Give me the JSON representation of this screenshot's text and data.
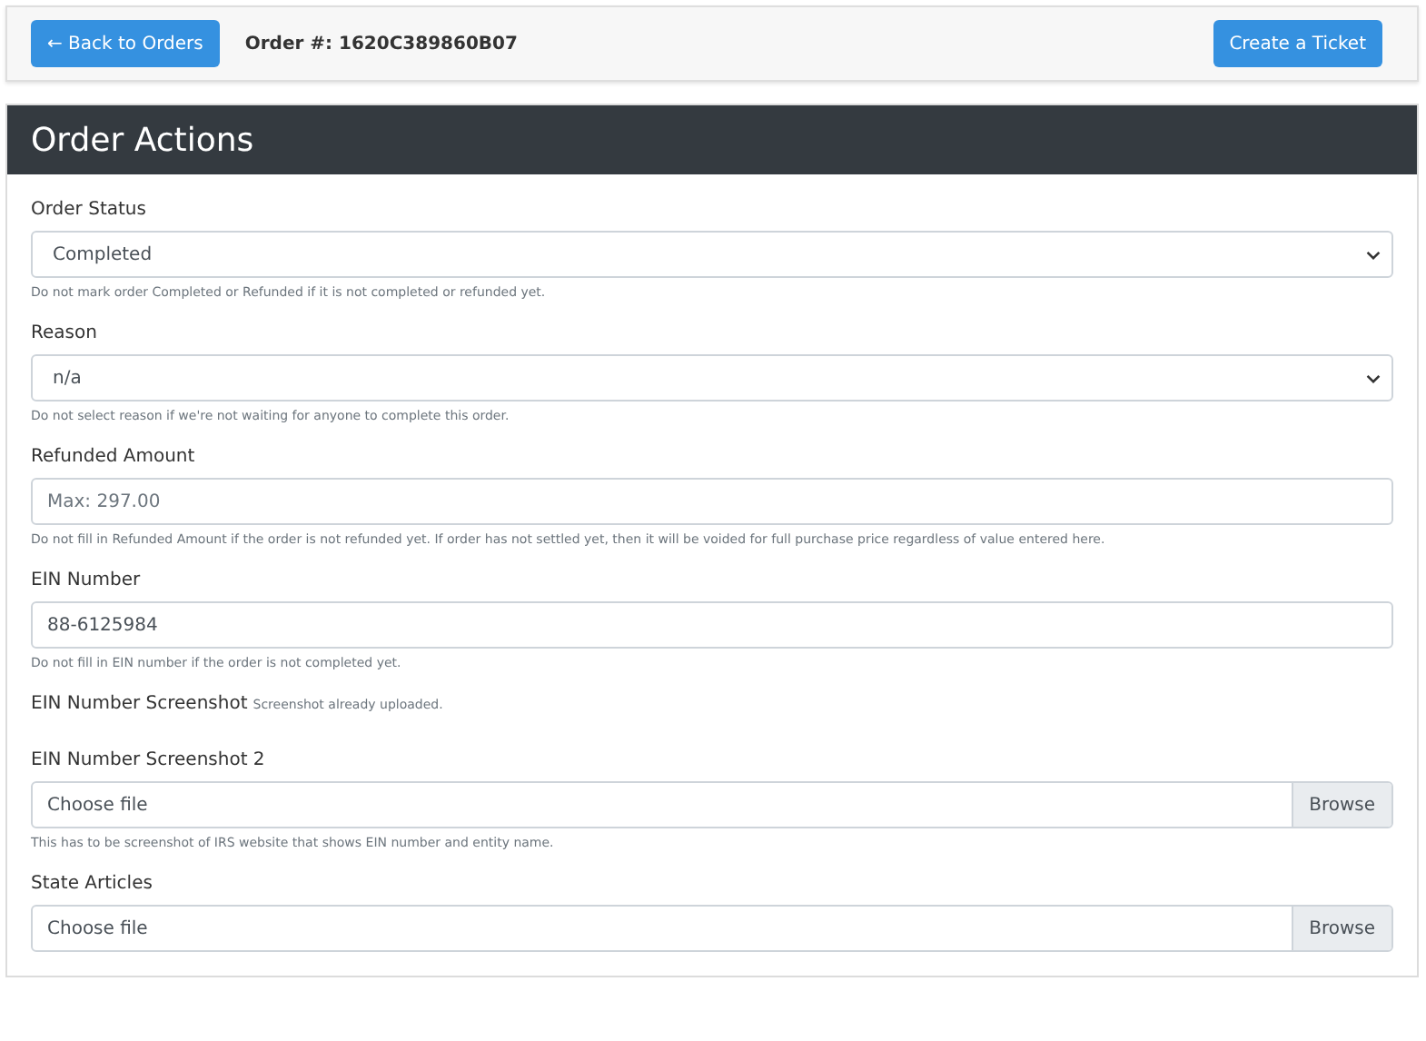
{
  "top_bar": {
    "back_button": "← Back to Orders",
    "order_label": "Order #: 1620C389860B07",
    "ticket_button": "Create a Ticket"
  },
  "card": {
    "title": "Order Actions",
    "fields": [
      {
        "kind": "select",
        "label": "Order Status",
        "value": "Completed",
        "help": "Do not mark order Completed or Refunded if it is not completed or refunded yet."
      },
      {
        "kind": "select",
        "label": "Reason",
        "value": "n/a",
        "help": "Do not select reason if we're not waiting for anyone to complete this order."
      },
      {
        "kind": "text",
        "label": "Refunded Amount",
        "placeholder": "Max: 297.00",
        "help": "Do not fill in Refunded Amount if the order is not refunded yet. If order has not settled yet, then it will be voided for full purchase price regardless of value entered here."
      },
      {
        "kind": "text",
        "label": "EIN Number",
        "value": "88-6125984",
        "help": "Do not fill in EIN number if the order is not completed yet."
      },
      {
        "kind": "status",
        "label": "EIN Number Screenshot",
        "note": "Screenshot already uploaded."
      },
      {
        "kind": "file",
        "label": "EIN Number Screenshot 2",
        "value": "Choose file",
        "button": "Browse",
        "help": "This has to be screenshot of IRS website that shows EIN number and entity name."
      },
      {
        "kind": "file",
        "label": "State Articles",
        "value": "Choose file",
        "button": "Browse"
      }
    ]
  }
}
